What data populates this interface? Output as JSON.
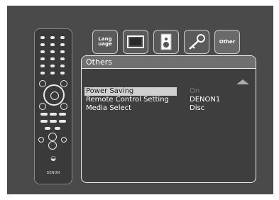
{
  "tabs": [
    {
      "id": "language",
      "label": "Lang\nuage"
    },
    {
      "id": "video",
      "label": ""
    },
    {
      "id": "audio",
      "label": ""
    },
    {
      "id": "ratings",
      "label": ""
    },
    {
      "id": "other",
      "label": "Other"
    }
  ],
  "panel": {
    "title": "Others",
    "rows": [
      {
        "label": "Power Saving",
        "value": "On",
        "selected": true
      },
      {
        "label": "Remote Control Setting",
        "value": "DENON1",
        "selected": false
      },
      {
        "label": "Media Select",
        "value": "Disc",
        "selected": false
      }
    ]
  },
  "remote": {
    "brand": "DENON"
  }
}
